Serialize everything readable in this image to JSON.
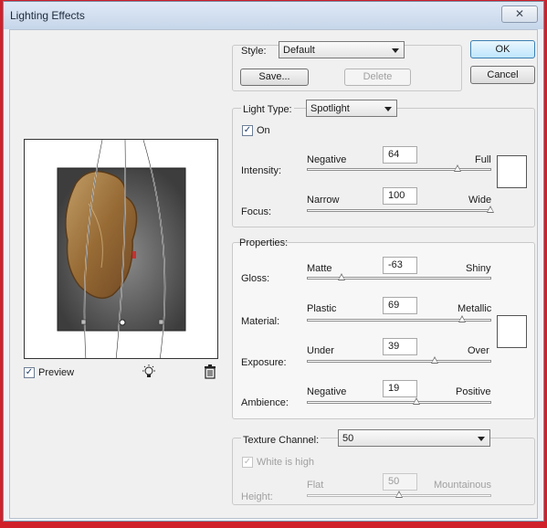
{
  "window": {
    "title": "Lighting Effects",
    "close_glyph": "✕"
  },
  "buttons": {
    "ok": "OK",
    "cancel": "Cancel",
    "save": "Save...",
    "delete": "Delete"
  },
  "style": {
    "label": "Style:",
    "value": "Default"
  },
  "light_type": {
    "label": "Light Type:",
    "value": "Spotlight",
    "on_label": "On",
    "on_checked": true
  },
  "intensity": {
    "label": "Intensity:",
    "min_label": "Negative",
    "max_label": "Full",
    "value": "64",
    "level": 0.82
  },
  "focus": {
    "label": "Focus:",
    "min_label": "Narrow",
    "max_label": "Wide",
    "value": "100",
    "level": 1.0
  },
  "properties": {
    "header": "Properties:",
    "gloss": {
      "label": "Gloss:",
      "min_label": "Matte",
      "max_label": "Shiny",
      "value": "-63",
      "level": 0.185
    },
    "material": {
      "label": "Material:",
      "min_label": "Plastic",
      "max_label": "Metallic",
      "value": "69",
      "level": 0.845
    },
    "exposure": {
      "label": "Exposure:",
      "min_label": "Under",
      "max_label": "Over",
      "value": "39",
      "level": 0.695
    },
    "ambience": {
      "label": "Ambience:",
      "min_label": "Negative",
      "max_label": "Positive",
      "value": "19",
      "level": 0.595
    }
  },
  "texture": {
    "label": "Texture Channel:",
    "value": "50",
    "white_is_high_label": "White is high",
    "height_label": "Height:",
    "min_label": "Flat",
    "max_label": "Mountainous",
    "level": 0.5
  },
  "preview": {
    "label": "Preview",
    "checked": true
  },
  "icons": {
    "light_bulb": "light-bulb-icon",
    "trash": "trash-icon"
  },
  "colors": {
    "accent": "#3c7fb1",
    "title_bar": "#c6d6ea",
    "frame": "#d0202a"
  }
}
